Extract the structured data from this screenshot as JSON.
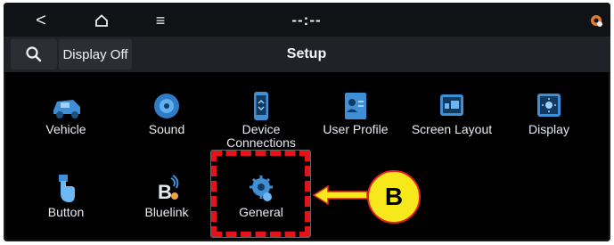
{
  "statusbar": {
    "back_glyph": "<",
    "menu_glyph": "≡",
    "clock": "--:--"
  },
  "titlebar": {
    "display_off_label": "Display Off",
    "title": "Setup"
  },
  "tiles": {
    "vehicle": "Vehicle",
    "sound": "Sound",
    "device_connections_line1": "Device",
    "device_connections_line2": "Connections",
    "user_profile": "User Profile",
    "screen_layout": "Screen Layout",
    "display": "Display",
    "button": "Button",
    "bluelink": "Bluelink",
    "general": "General"
  },
  "annotation": {
    "callout_letter": "B",
    "box_color": "#e3121b",
    "callout_fill": "#f6e81a"
  },
  "colors": {
    "background": "#000000",
    "icon_blue": "#3f8fd6"
  },
  "icons": [
    "back-icon",
    "home-icon",
    "menu-icon",
    "settings-icon",
    "search-icon",
    "vehicle-icon",
    "sound-icon",
    "device-connections-icon",
    "user-profile-icon",
    "screen-layout-icon",
    "display-icon",
    "button-icon",
    "bluelink-icon",
    "general-icon"
  ]
}
